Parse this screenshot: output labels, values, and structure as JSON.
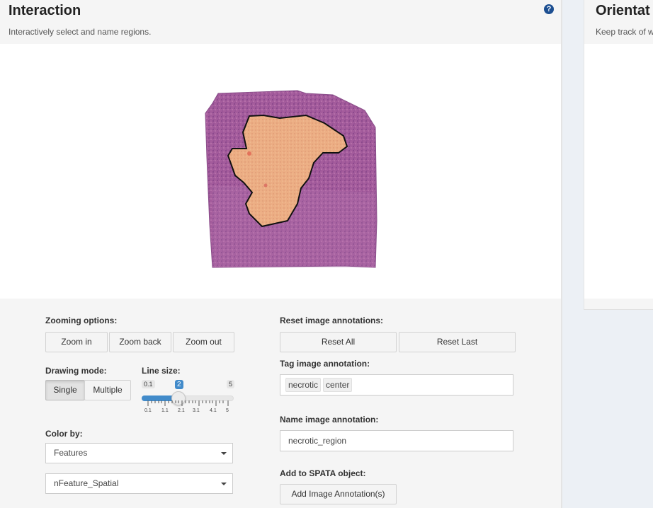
{
  "interaction_panel": {
    "title": "Interaction",
    "subtitle": "Interactively select and name regions.",
    "help_icon": "question-circle-icon"
  },
  "orientation_panel": {
    "title": "Orientat",
    "subtitle": "Keep track of w"
  },
  "zoom": {
    "label": "Zooming options:",
    "zoom_in": "Zoom in",
    "zoom_back": "Zoom back",
    "zoom_out": "Zoom out"
  },
  "drawing_mode": {
    "label": "Drawing mode:",
    "options": [
      "Single",
      "Multiple"
    ],
    "selected": "Single"
  },
  "line_size": {
    "label": "Line size:",
    "min": "0.1",
    "max": "5",
    "value": "2",
    "ticks": [
      "0.1",
      "1.1",
      "2.1",
      "3.1",
      "4.1",
      "5"
    ]
  },
  "color_by": {
    "label": "Color by:",
    "selected": "Features",
    "feature": "nFeature_Spatial"
  },
  "reset": {
    "label": "Reset image annotations:",
    "reset_all": "Reset All",
    "reset_last": "Reset Last"
  },
  "tags": {
    "label": "Tag image annotation:",
    "values": [
      "necrotic",
      "center"
    ]
  },
  "name": {
    "label": "Name image annotation:",
    "value": "necrotic_region"
  },
  "spata": {
    "label": "Add to SPATA object:",
    "button": "Add Image Annotation(s)"
  },
  "colors": {
    "accent": "#428bca",
    "tissue": "#a35a9a",
    "region_fill": "#e8a77a"
  }
}
